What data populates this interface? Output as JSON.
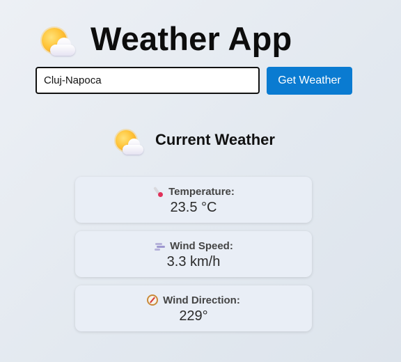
{
  "header": {
    "icon": "sun-behind-cloud-icon",
    "title": "Weather App"
  },
  "search": {
    "value": "Cluj-Napoca",
    "button_label": "Get Weather"
  },
  "current": {
    "icon": "sun-behind-cloud-icon",
    "title": "Current Weather",
    "cards": [
      {
        "icon": "thermometer-icon",
        "label": "Temperature:",
        "value": "23.5 °C"
      },
      {
        "icon": "wind-icon",
        "label": "Wind Speed:",
        "value": "3.3 km/h"
      },
      {
        "icon": "compass-icon",
        "label": "Wind Direction:",
        "value": "229°"
      }
    ]
  },
  "colors": {
    "accent": "#0a7bd1",
    "card_background": "#e9eef6"
  }
}
